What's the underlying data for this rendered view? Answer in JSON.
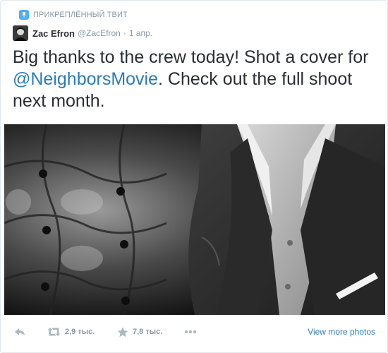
{
  "pinned": {
    "label": "ПРИКРЕПЛЁННЫЙ ТВИТ",
    "icon": "pin-icon"
  },
  "author": {
    "fullname": "Zac Efron",
    "username": "@ZacEfron",
    "separator": "·",
    "time": "1 апр."
  },
  "tweet": {
    "text_before": "Big thanks to the crew today! Shot a cover for ",
    "mention": "@NeighborsMovie",
    "text_after": ". Check out the full shoot next month."
  },
  "media": {
    "description_icon": "photo"
  },
  "actions": {
    "reply_icon": "reply-icon",
    "retweet_icon": "retweet-icon",
    "retweet_count": "2,9 тыс.",
    "favorite_icon": "star-icon",
    "favorite_count": "7,8 тыс.",
    "more_icon": "more-icon",
    "view_more_label": "View more photos"
  },
  "colors": {
    "accent": "#55acee",
    "link": "#2b7bb9",
    "muted": "#8899a6",
    "text": "#292f33"
  }
}
